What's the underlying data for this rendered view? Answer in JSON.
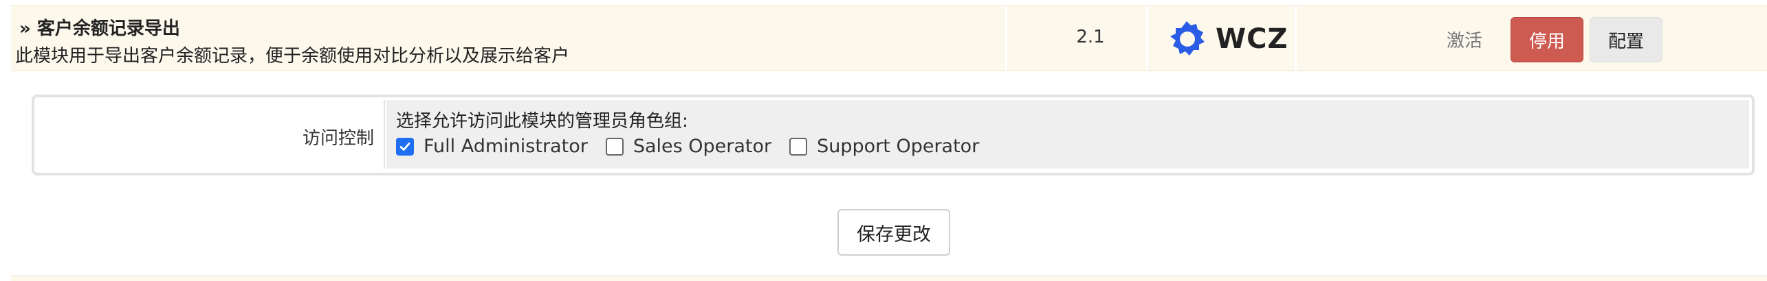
{
  "module": {
    "title": "» 客户余额记录导出",
    "description": "此模块用于导出客户余额记录，便于余额使用对比分析以及展示给客户",
    "version": "2.1",
    "vendor_logo_text": "WCZ",
    "vendor_logo_icon": "gear-logo-icon",
    "activate_label": "激活",
    "disable_label": "停用",
    "config_label": "配置"
  },
  "access_control": {
    "label": "访问控制",
    "heading": "选择允许访问此模块的管理员角色组:",
    "roles": [
      {
        "label": "Full Administrator",
        "checked": true
      },
      {
        "label": "Sales Operator",
        "checked": false
      },
      {
        "label": "Support Operator",
        "checked": false
      }
    ]
  },
  "save_label": "保存更改",
  "colors": {
    "row_background": "#fcf8ec",
    "disable_button": "#cd5b52",
    "logo_blue": "#2b5ce6",
    "checkbox_checked": "#1f6ff2"
  }
}
